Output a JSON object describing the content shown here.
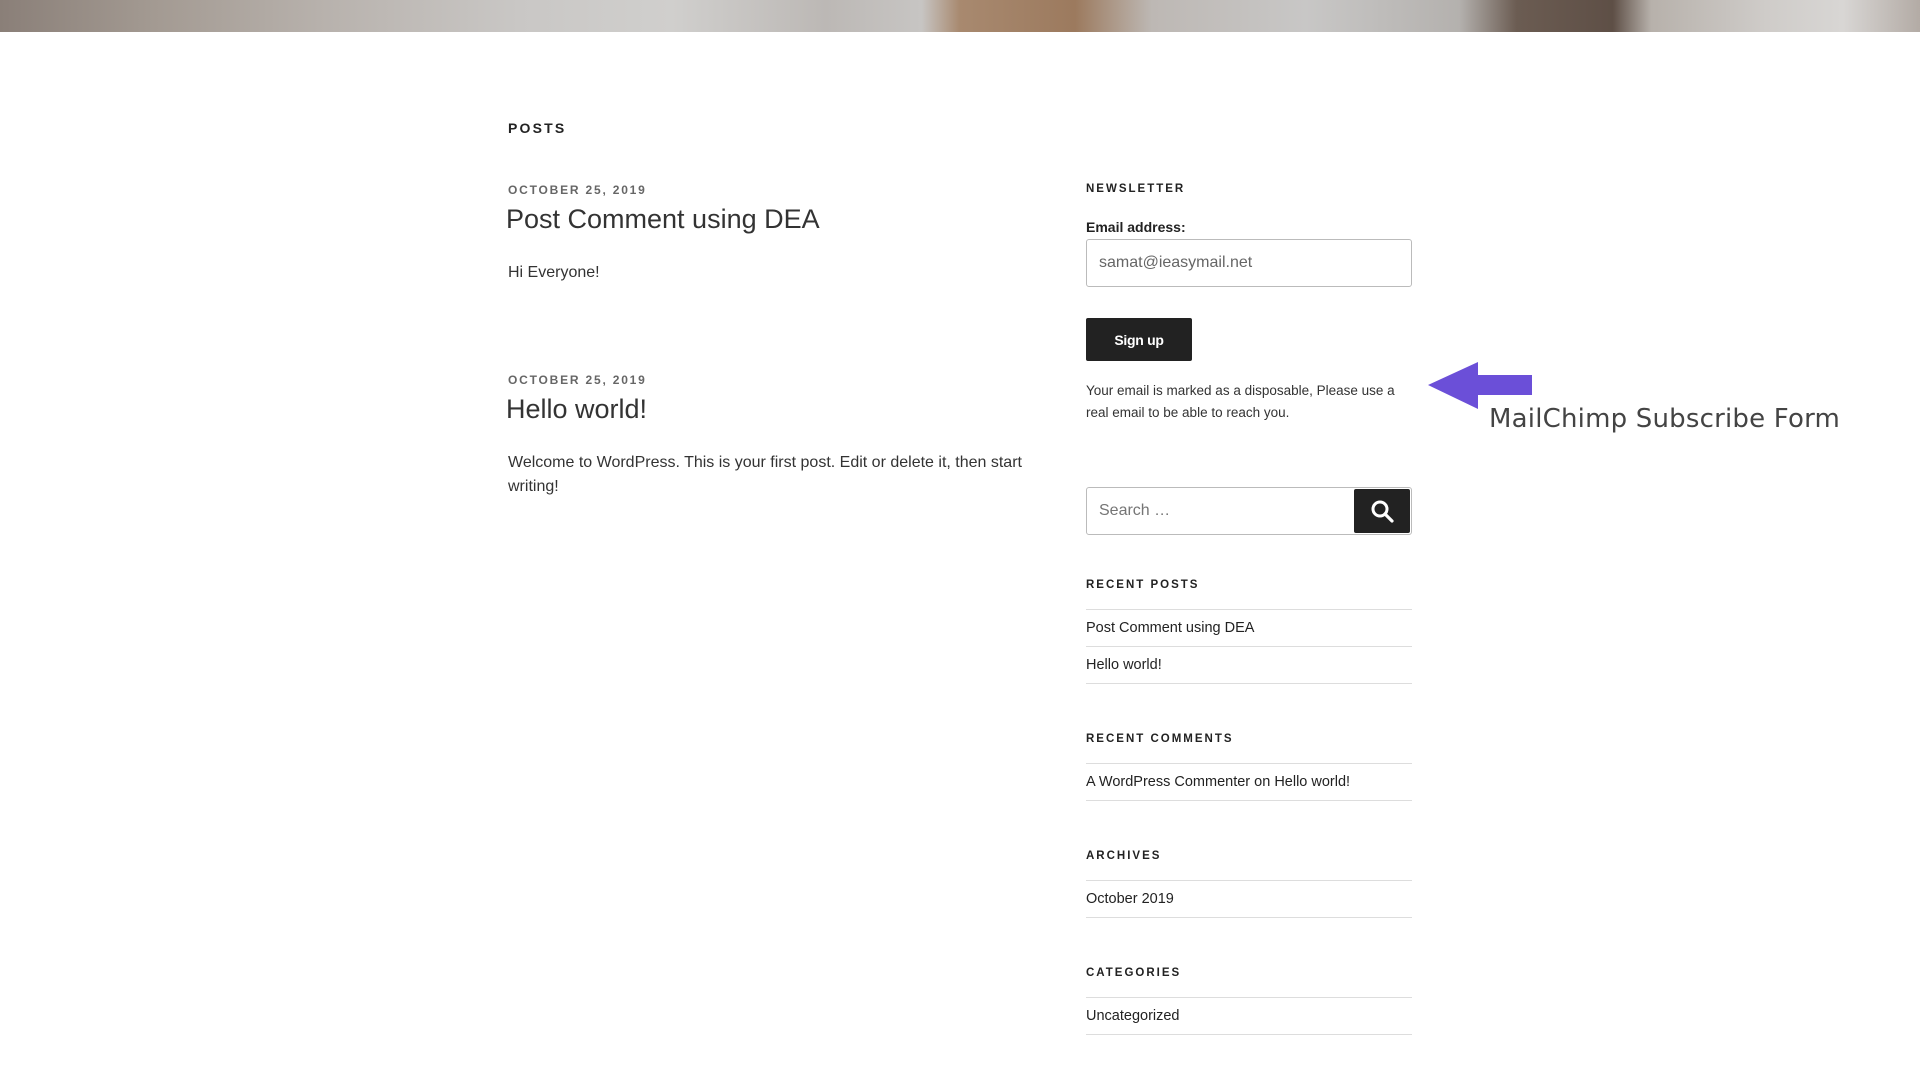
{
  "main": {
    "section_heading": "Posts",
    "posts": [
      {
        "date": "October 25, 2019",
        "title": "Post Comment using DEA",
        "excerpt": "Hi Everyone!"
      },
      {
        "date": "October 25, 2019",
        "title": "Hello world!",
        "excerpt": "Welcome to WordPress. This is your first post. Edit or delete it, then start writing!"
      }
    ]
  },
  "newsletter": {
    "title": "Newsletter",
    "email_label": "Email address:",
    "email_value": "samat@ieasymail.net",
    "signup_label": "Sign up",
    "error_message": "Your email is marked as a disposable, Please use a real email to be able to reach you."
  },
  "search": {
    "placeholder": "Search …",
    "icon": "search-icon"
  },
  "recent_posts": {
    "title": "Recent Posts",
    "items": [
      "Post Comment using DEA",
      "Hello world!"
    ]
  },
  "recent_comments": {
    "title": "Recent Comments",
    "author": "A WordPress Commenter",
    "connector": "on",
    "post": "Hello world!"
  },
  "archives": {
    "title": "Archives",
    "items": [
      "October 2019"
    ]
  },
  "categories": {
    "title": "Categories",
    "items": [
      "Uncategorized"
    ]
  },
  "annotation": {
    "label": "MailChimp Subscribe Form",
    "arrow_color": "#6b4fd8"
  }
}
